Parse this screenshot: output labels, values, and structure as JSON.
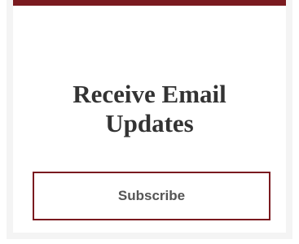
{
  "card": {
    "title_line1": "Receive Email",
    "title_line2": "Updates",
    "accent_color": "#7a1a1f"
  },
  "subscribe_button": {
    "label": "Subscribe"
  }
}
